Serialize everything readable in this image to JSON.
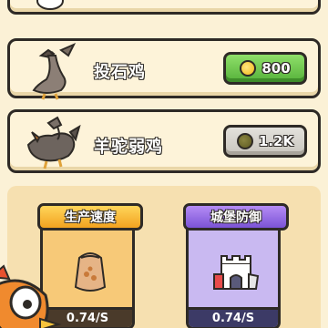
{
  "shop_items": [
    {
      "name": "投石鸡",
      "price": "800",
      "currency_icon": "gold-coin-icon",
      "affordable": true,
      "button_color": "#56b13a"
    },
    {
      "name": "羊驼弱鸡",
      "price": "1.2K",
      "currency_icon": "dark-coin-icon",
      "affordable": false,
      "button_color": "#c8c5bd"
    }
  ],
  "upgrades": [
    {
      "title": "生产速度",
      "rate": "0.74/S",
      "icon": "grain-sack-icon",
      "color": "#f7c978"
    },
    {
      "title": "城堡防御",
      "rate": "0.74/S",
      "icon": "castle-icon",
      "color": "#c9b9f1"
    }
  ]
}
